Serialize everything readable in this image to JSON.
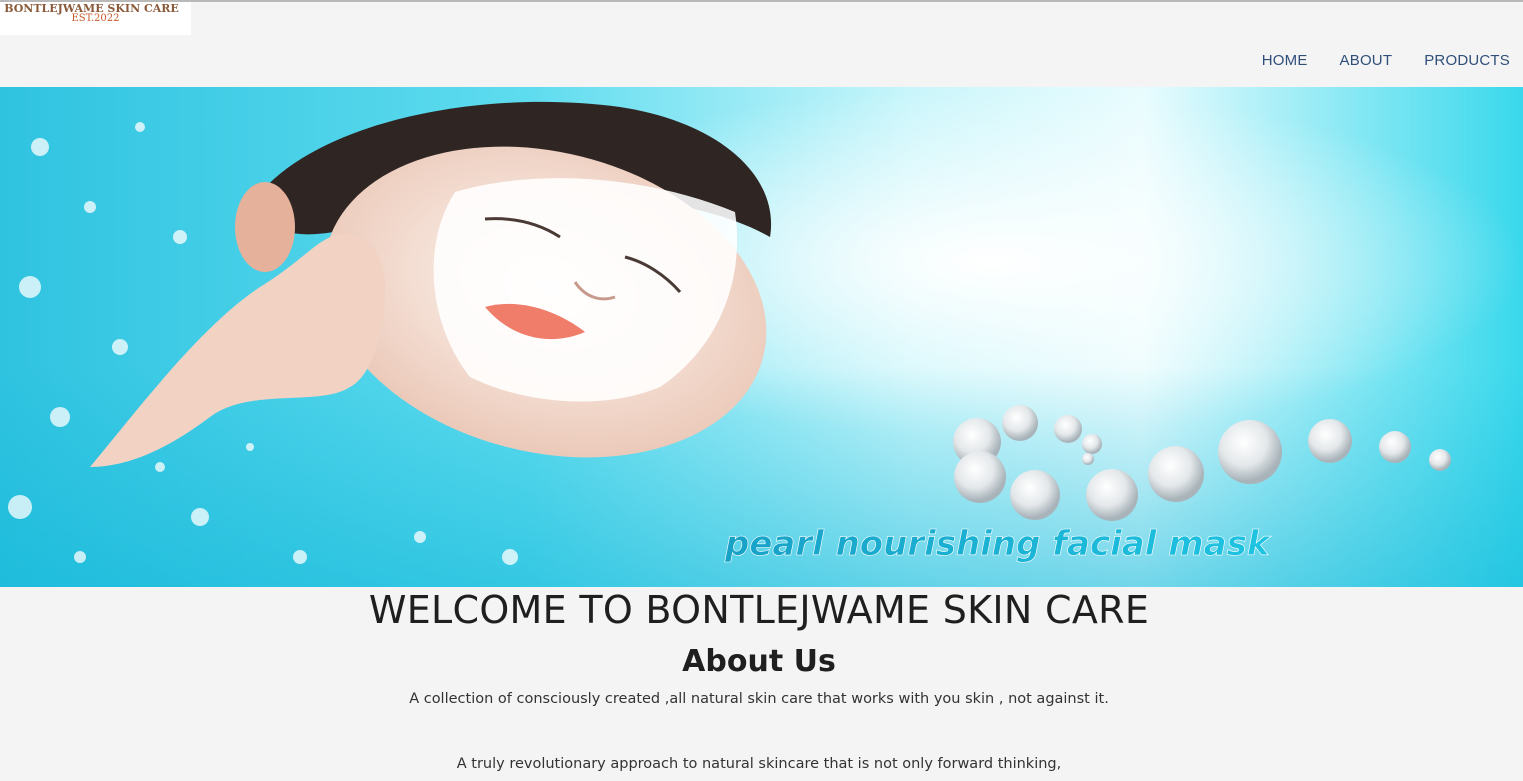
{
  "header": {
    "logo_brand": "BONTLEJWAME SKIN CARE",
    "logo_est": "EST.2022",
    "nav": [
      {
        "label": "HOME"
      },
      {
        "label": "ABOUT"
      },
      {
        "label": "PRODUCTS"
      }
    ]
  },
  "hero": {
    "banner_caption": "pearl nourishing facial mask"
  },
  "main": {
    "welcome_heading": "WELCOME TO BONTLEJWAME SKIN CARE",
    "about_heading": "About Us",
    "paragraph_1": "A collection of consciously created ,all natural skin care that works with you skin , not against it.",
    "paragraph_2": "A truly revolutionary approach to natural skincare that is not only forward thinking,"
  },
  "colors": {
    "page_background": "#f4f4f4",
    "nav_link": "#2f4f7a",
    "hero_aqua": "#35d3ea",
    "caption_blue": "#1aa6c8"
  }
}
